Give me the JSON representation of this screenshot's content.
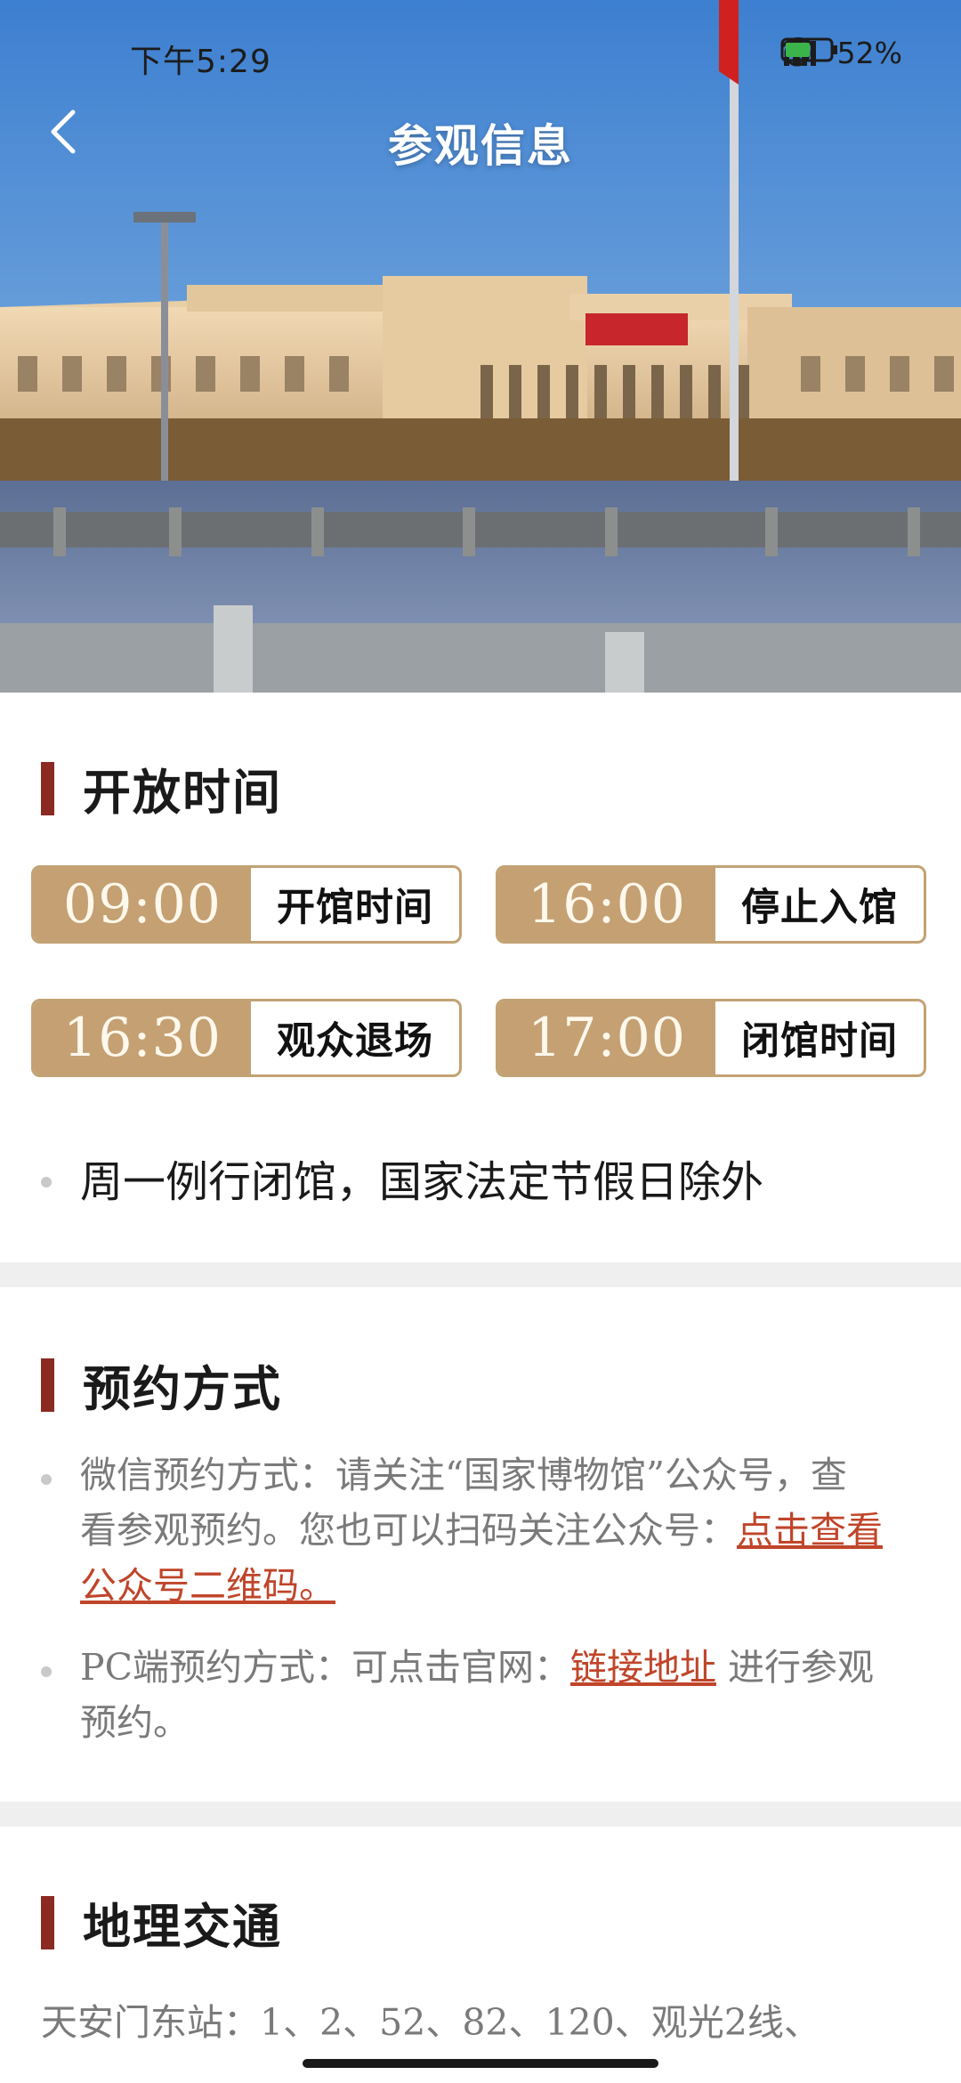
{
  "status_bar": {
    "time": "下午5:29",
    "battery": "52%",
    "icons": [
      "alarm-icon",
      "hd-signal-icon",
      "wifi-icon",
      "battery-icon"
    ]
  },
  "header": {
    "title": "参观信息",
    "back_icon": "chevron-left-icon"
  },
  "hero_image": {
    "description_icon": "museum-photo"
  },
  "opening_hours": {
    "title": "开放时间",
    "cards": [
      {
        "time": "09:00",
        "label": "开馆时间"
      },
      {
        "time": "16:00",
        "label": "停止入馆"
      },
      {
        "time": "16:30",
        "label": "观众退场"
      },
      {
        "time": "17:00",
        "label": "闭馆时间"
      }
    ],
    "notice": "周一例行闭馆，国家法定节假日除外"
  },
  "reservation": {
    "title": "预约方式",
    "wechat_text_line1": "微信预约方式：请关注“国家博物馆”公众号，查",
    "wechat_text_line2": "看参观预约。您也可以扫码关注公众号：",
    "wechat_link_part1": "点击查看",
    "wechat_link_part2": "公众号二维码。",
    "pc_text_prefix": "PC端预约方式：可点击官网：",
    "pc_link": "链接地址",
    "pc_text_suffix": " 进行参观",
    "pc_text_line2": "预约。"
  },
  "transport": {
    "title": "地理交通",
    "line1": "天安门东站：1、2、52、82、120、观光2线、"
  },
  "colors": {
    "accent_red": "#8b2a22",
    "gold": "#c4a073",
    "link": "#c0452a"
  }
}
